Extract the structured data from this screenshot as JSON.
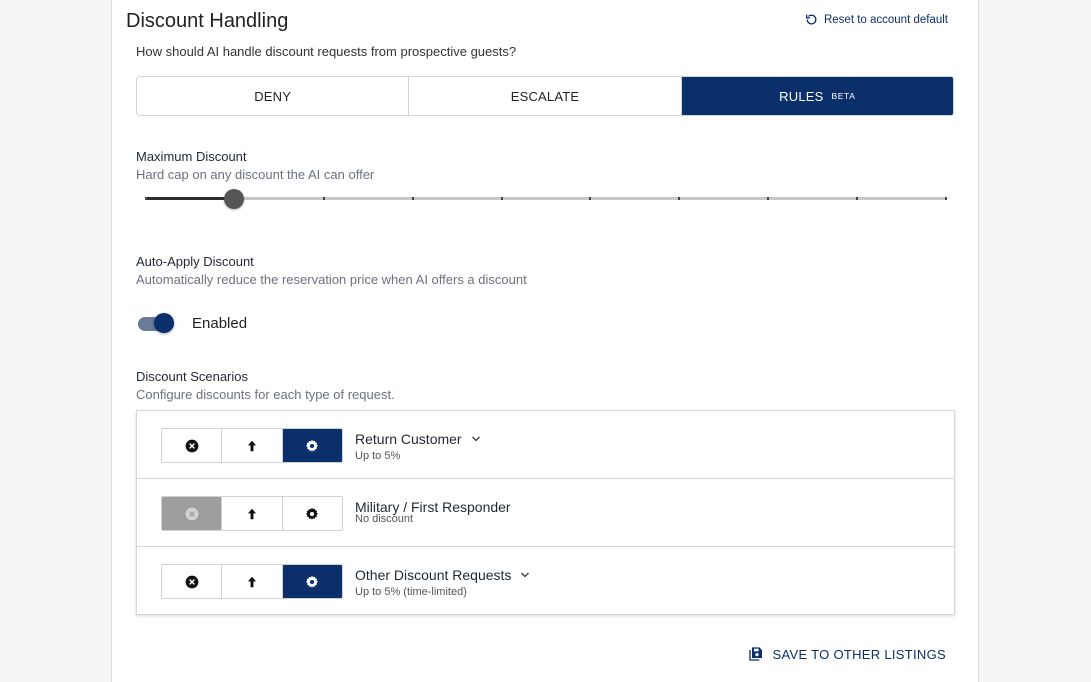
{
  "header": {
    "title": "Discount Handling",
    "reset_label": "Reset to account default",
    "question": "How should AI handle discount requests from prospective guests?"
  },
  "mode_tabs": [
    {
      "label": "DENY",
      "badge": "",
      "selected": false
    },
    {
      "label": "ESCALATE",
      "badge": "",
      "selected": false
    },
    {
      "label": "RULES",
      "badge": "BETA",
      "selected": true
    }
  ],
  "max_discount": {
    "label": "Maximum Discount",
    "description": "Hard cap on any discount the AI can offer",
    "slider_fraction": 0.11,
    "step_count": 9
  },
  "auto_apply": {
    "label": "Auto-Apply Discount",
    "description": "Automatically reduce the reservation price when AI offers a discount",
    "toggle_label": "Enabled",
    "enabled": true
  },
  "scenarios": {
    "label": "Discount Scenarios",
    "description": "Configure discounts for each type of request.",
    "items": [
      {
        "name": "Return Customer",
        "subtitle": "Up to 5%",
        "selected_action": "configure",
        "expandable": true
      },
      {
        "name": "Military / First Responder",
        "subtitle": "No discount",
        "selected_action": "deny",
        "expandable": false
      },
      {
        "name": "Other Discount Requests",
        "subtitle": "Up to 5% (time-limited)",
        "selected_action": "configure",
        "expandable": true
      }
    ]
  },
  "footer": {
    "save_label": "SAVE TO OTHER LISTINGS"
  },
  "colors": {
    "primary": "#0b2f6b",
    "deny_selected": "#9e9e9e"
  }
}
